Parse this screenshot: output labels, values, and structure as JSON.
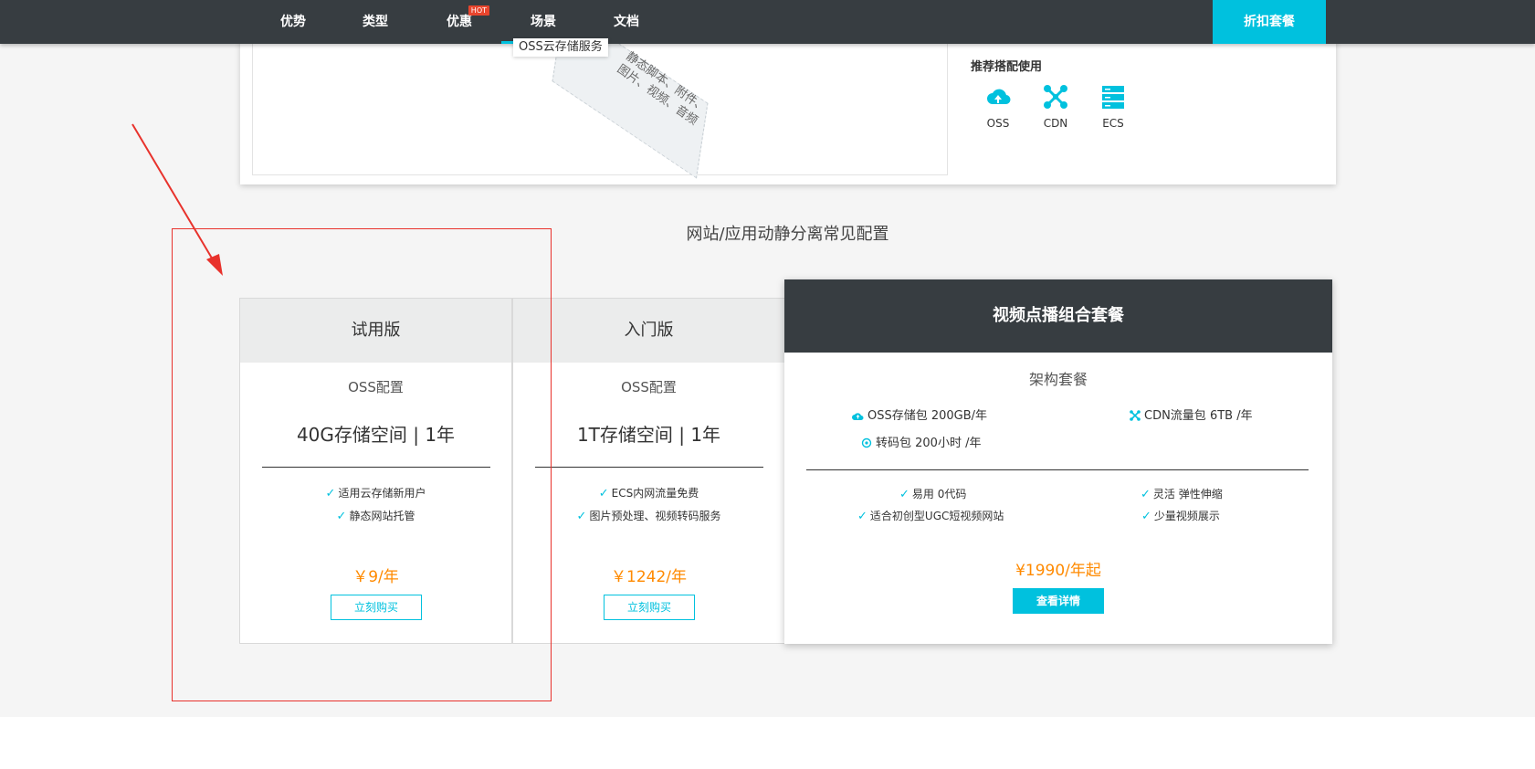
{
  "nav": {
    "items": [
      {
        "label": "优势"
      },
      {
        "label": "类型"
      },
      {
        "label": "优惠",
        "badge": "HOT"
      },
      {
        "label": "场景"
      },
      {
        "label": "文档"
      }
    ],
    "active": "场景",
    "cta": "折扣套餐"
  },
  "top_card": {
    "oss_tag": "OSS云存储服务",
    "diagram_text": "静态脚本、附件、图片、视频、音频",
    "recommend_title": "推荐搭配使用",
    "recommend": [
      {
        "label": "OSS",
        "icon": "cloud-upload-icon"
      },
      {
        "label": "CDN",
        "icon": "network-nodes-icon"
      },
      {
        "label": "ECS",
        "icon": "server-stack-icon"
      }
    ]
  },
  "section_title": "网站/应用动静分离常见配置",
  "plans": [
    {
      "name": "试用版",
      "sub": "OSS配置",
      "spec": "40G存储空间 | 1年",
      "features": [
        "适用云存储新用户",
        "静态网站托管"
      ],
      "price": "￥9/年",
      "button": "立刻购买"
    },
    {
      "name": "入门版",
      "sub": "OSS配置",
      "spec": "1T存储空间 | 1年",
      "features": [
        "ECS内网流量免费",
        "图片预处理、视频转码服务"
      ],
      "price": "￥1242/年",
      "button": "立刻购买"
    }
  ],
  "featured": {
    "title": "视频点播组合套餐",
    "sub": "架构套餐",
    "packages": [
      "OSS存储包 200GB/年",
      "CDN流量包 6TB /年",
      "转码包 200小时 /年"
    ],
    "features": [
      "易用 0代码",
      "灵活 弹性伸缩",
      "适合初创型UGC短视频网站",
      "少量视频展示"
    ],
    "price": "¥1990/年起",
    "button": "查看详情"
  },
  "colors": {
    "accent": "#00c1de",
    "nav_bg": "#373d41",
    "price": "#ff8a00",
    "annotation": "#e8322c"
  }
}
